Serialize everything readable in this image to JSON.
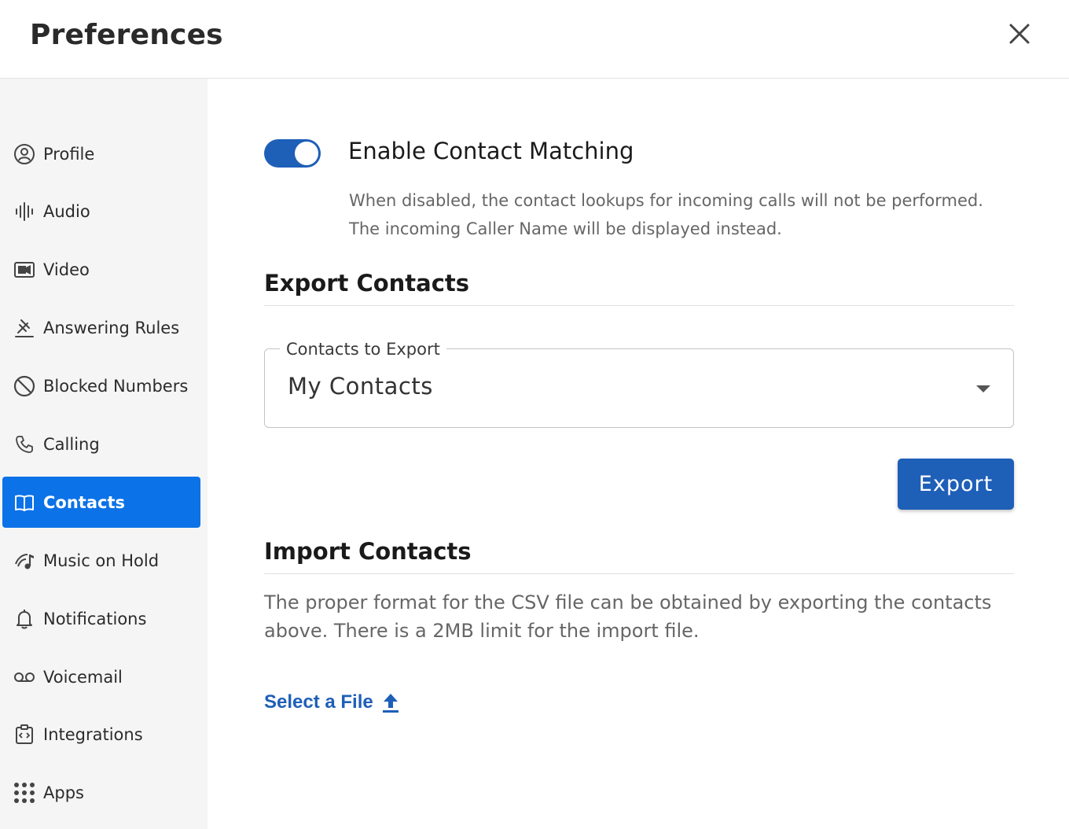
{
  "header": {
    "title": "Preferences"
  },
  "sidebar": {
    "items": [
      {
        "label": "Profile",
        "icon": "profile-icon"
      },
      {
        "label": "Audio",
        "icon": "audio-icon"
      },
      {
        "label": "Video",
        "icon": "video-icon"
      },
      {
        "label": "Answering Rules",
        "icon": "answering-rules-icon"
      },
      {
        "label": "Blocked Numbers",
        "icon": "blocked-icon"
      },
      {
        "label": "Calling",
        "icon": "phone-icon"
      },
      {
        "label": "Contacts",
        "icon": "book-icon",
        "active": true
      },
      {
        "label": "Music on Hold",
        "icon": "music-icon"
      },
      {
        "label": "Notifications",
        "icon": "bell-icon"
      },
      {
        "label": "Voicemail",
        "icon": "voicemail-icon"
      },
      {
        "label": "Integrations",
        "icon": "integrations-icon"
      },
      {
        "label": "Apps",
        "icon": "apps-grid-icon"
      }
    ]
  },
  "contact_matching": {
    "label": "Enable Contact Matching",
    "enabled": true,
    "description_line1": "When disabled, the contact lookups for incoming calls will not be performed.",
    "description_line2": "The incoming Caller Name will be displayed instead."
  },
  "export": {
    "title": "Export Contacts",
    "select_label": "Contacts to Export",
    "select_value": "My Contacts",
    "button_label": "Export"
  },
  "import": {
    "title": "Import Contacts",
    "description": "The proper format for the CSV file can be obtained by exporting the contacts above. There is a 2MB limit for the import file.",
    "select_file_label": "Select a File"
  },
  "colors": {
    "accent": "#1e5fb8",
    "active_nav": "#0b72e7",
    "sidebar_bg": "#f5f5f5"
  }
}
